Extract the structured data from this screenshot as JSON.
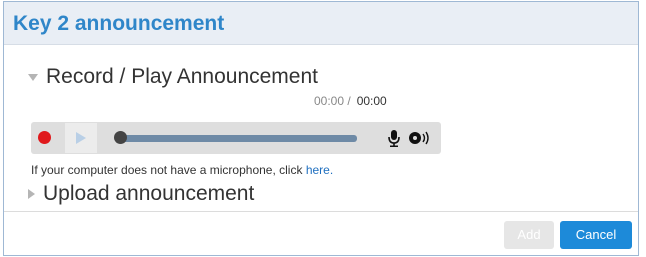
{
  "dialog": {
    "title": "Key 2 announcement"
  },
  "record_section": {
    "label": "Record / Play Announcement",
    "current_time": "00:00 /",
    "duration": "00:00"
  },
  "player": {
    "record_icon": "record-dot-icon",
    "play_icon": "play-icon",
    "mic_icon": "microphone-icon",
    "speaker_icon": "speaker-icon",
    "progress": 0
  },
  "note": {
    "text": "If your computer does not have a microphone, click ",
    "link": "here."
  },
  "upload_section": {
    "label": "Upload announcement"
  },
  "buttons": {
    "add": "Add",
    "cancel": "Cancel"
  },
  "colors": {
    "title": "#2f86c9",
    "record": "#e0191c",
    "primary_button": "#1d8ad9",
    "disabled_button": "#e6e6e6"
  }
}
